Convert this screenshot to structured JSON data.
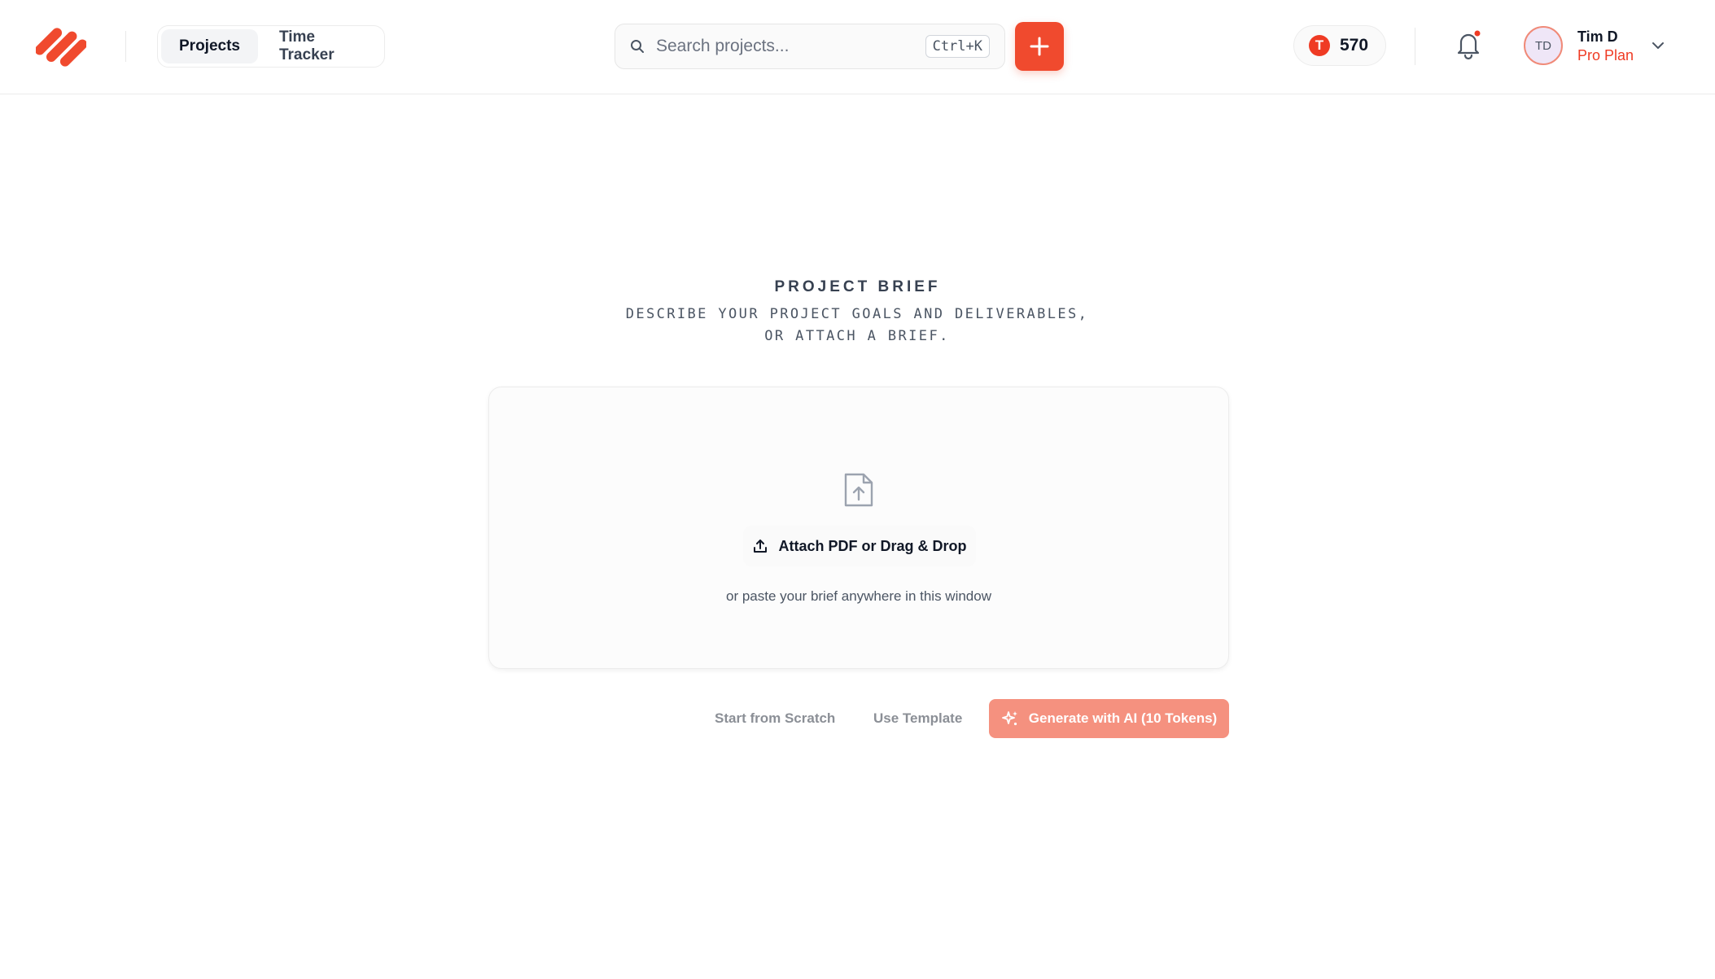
{
  "header": {
    "tabs": [
      {
        "label": "Projects",
        "active": true
      },
      {
        "label": "Time Tracker",
        "active": false
      }
    ],
    "search": {
      "placeholder": "Search projects...",
      "value": "",
      "shortcut": "Ctrl+K"
    },
    "tokens": {
      "coin_letter": "T",
      "count": "570"
    },
    "notifications": {
      "has_unread": true
    },
    "user": {
      "initials": "TD",
      "name": "Tim D",
      "plan": "Pro Plan"
    }
  },
  "brief": {
    "title": "PROJECT BRIEF",
    "subtitle": "DESCRIBE YOUR PROJECT GOALS AND DELIVERABLES, OR ATTACH A BRIEF.",
    "attach_label": "Attach PDF or Drag & Drop",
    "paste_hint": "or paste your brief anywhere in this window"
  },
  "actions": {
    "scratch_label": "Start from Scratch",
    "template_label": "Use Template",
    "generate_label": "Generate with AI (10 Tokens)"
  },
  "colors": {
    "brand": "#f04a2e",
    "brand_light": "#f5917f",
    "accent_text": "#ef3b24"
  },
  "icons": {
    "logo": "brand-logo-icon",
    "search": "search-icon",
    "add": "plus-icon",
    "token": "token-coin-icon",
    "bell": "bell-icon",
    "chevron": "chevron-down-icon",
    "file": "file-upload-icon",
    "upload": "upload-icon",
    "sparkle": "sparkle-icon"
  }
}
